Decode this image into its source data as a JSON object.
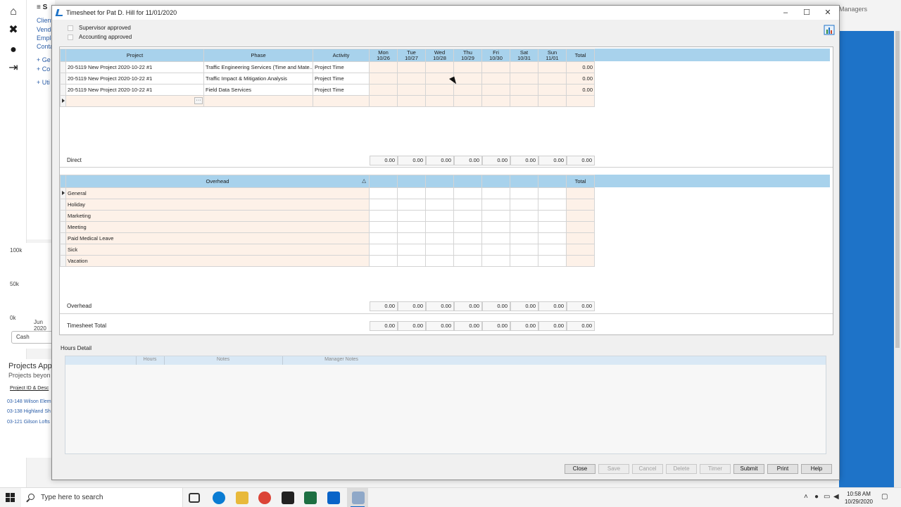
{
  "background": {
    "nav_menu": "≡ S",
    "panel_items": [
      "Client",
      "Vendo",
      "Emplo",
      "Conta",
      "+ Ge",
      "+ Co",
      "+ Uti"
    ],
    "chart_labels": [
      "100k",
      "50k",
      "0k",
      "Jun 2020"
    ],
    "legend": "Cash",
    "projects_title": "Projects App",
    "projects_subtitle": "Projects beyon",
    "projects_col": "Project ID & Desc",
    "projects_rows": [
      "03-148 Wilson Elem",
      "03-138 Highland Sh",
      "03-121 Gilson Lofts"
    ],
    "managers_label": "Managers"
  },
  "dialog": {
    "title": "Timesheet for Pat D. Hill for 11/01/2020",
    "controls": {
      "minimize": "–",
      "maximize": "☐",
      "close": "✕"
    },
    "supervisor_approved": "Supervisor approved",
    "accounting_approved": "Accounting approved"
  },
  "direct": {
    "columns": {
      "project": "Project",
      "phase": "Phase",
      "activity": "Activity",
      "days": [
        {
          "day": "Mon",
          "date": "10/26"
        },
        {
          "day": "Tue",
          "date": "10/27"
        },
        {
          "day": "Wed",
          "date": "10/28"
        },
        {
          "day": "Thu",
          "date": "10/29"
        },
        {
          "day": "Fri",
          "date": "10/30"
        },
        {
          "day": "Sat",
          "date": "10/31"
        },
        {
          "day": "Sun",
          "date": "11/01"
        }
      ],
      "total": "Total"
    },
    "rows": [
      {
        "project": "20-5119 New Project 2020-10-22 #1",
        "phase": "Traffic Engineering Services (Time and Mate...",
        "activity": "Project Time",
        "total": "0.00"
      },
      {
        "project": "20-5119 New Project 2020-10-22 #1",
        "phase": "Traffic Impact & Mitigation Analysis",
        "activity": "Project Time",
        "total": "0.00"
      },
      {
        "project": "20-5119 New Project 2020-10-22 #1",
        "phase": "Field Data Services",
        "activity": "Project Time",
        "total": "0.00"
      }
    ],
    "ellipsis": "···",
    "summary_label": "Direct",
    "summary_values": [
      "0.00",
      "0.00",
      "0.00",
      "0.00",
      "0.00",
      "0.00",
      "0.00",
      "0.00"
    ]
  },
  "overhead": {
    "column": "Overhead",
    "sort_indicator": "△",
    "total": "Total",
    "rows": [
      "General",
      "Holiday",
      "Marketing",
      "Meeting",
      "Paid Medical Leave",
      "Sick",
      "Vacation"
    ],
    "summary_label": "Overhead",
    "summary_values": [
      "0.00",
      "0.00",
      "0.00",
      "0.00",
      "0.00",
      "0.00",
      "0.00",
      "0.00"
    ]
  },
  "timesheet_total": {
    "label": "Timesheet Total",
    "values": [
      "0.00",
      "0.00",
      "0.00",
      "0.00",
      "0.00",
      "0.00",
      "0.00",
      "0.00"
    ]
  },
  "hours_detail": {
    "label": "Hours Detail",
    "columns": [
      "Hours",
      "Notes",
      "Manager Notes"
    ]
  },
  "buttons": {
    "close": "Close",
    "save": "Save",
    "cancel": "Cancel",
    "delete": "Delete",
    "timer": "Timer",
    "submit": "Submit",
    "print": "Print",
    "help": "Help"
  },
  "taskbar": {
    "search_placeholder": "Type here to search",
    "time": "10:58 AM",
    "date": "10/29/2020"
  },
  "colors": {
    "header_blue": "#a8d2ec",
    "overhead_pink": "#fdf1e8",
    "accent": "#1e73c8"
  }
}
